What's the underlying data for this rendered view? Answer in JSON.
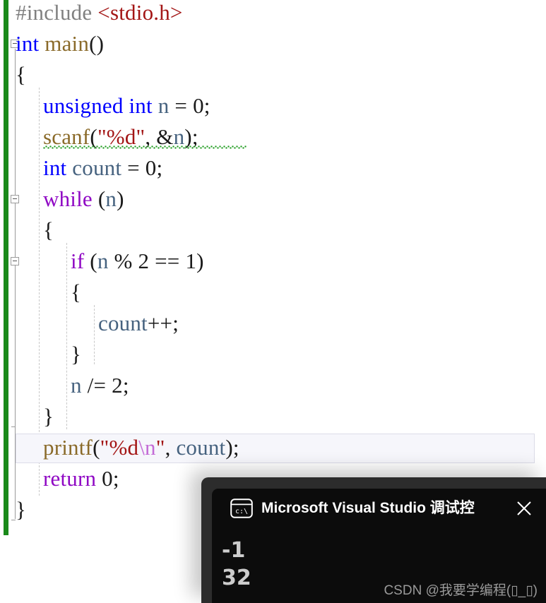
{
  "editor": {
    "language": "c",
    "background": "#ffffff",
    "change_bar_color": "#1a8a1a",
    "current_line_index": 12,
    "lines": [
      {
        "indent": 0,
        "text": "#include <stdio.h>"
      },
      {
        "indent": 0,
        "text": "int main()"
      },
      {
        "indent": 0,
        "text": "{"
      },
      {
        "indent": 1,
        "text": "unsigned int n = 0;"
      },
      {
        "indent": 1,
        "text": "scanf(\"%d\", &n);"
      },
      {
        "indent": 1,
        "text": "int count = 0;"
      },
      {
        "indent": 1,
        "text": "while (n)"
      },
      {
        "indent": 1,
        "text": "{"
      },
      {
        "indent": 2,
        "text": "if (n % 2 == 1)"
      },
      {
        "indent": 2,
        "text": "{"
      },
      {
        "indent": 3,
        "text": "count++;"
      },
      {
        "indent": 2,
        "text": "}"
      },
      {
        "indent": 2,
        "text": "n /= 2;"
      },
      {
        "indent": 1,
        "text": "}"
      },
      {
        "indent": 1,
        "text": "printf(\"%d\\n\", count);"
      },
      {
        "indent": 1,
        "text": "return 0;"
      },
      {
        "indent": 0,
        "text": "}"
      }
    ],
    "tokens": {
      "line0": [
        {
          "text": "#include ",
          "cls": "t-pre"
        },
        {
          "text": "<stdio.h>",
          "cls": "t-inc"
        }
      ],
      "line1": [
        {
          "text": "int",
          "cls": "t-key"
        },
        {
          "text": " main",
          "cls": "t-fn"
        },
        {
          "text": "()",
          "cls": "t-punct"
        }
      ],
      "line2": [
        {
          "text": "{",
          "cls": "t-punct"
        }
      ],
      "line3": [
        {
          "text": "unsigned int",
          "cls": "t-key"
        },
        {
          "text": " ",
          "cls": "t-punct"
        },
        {
          "text": "n",
          "cls": "t-var"
        },
        {
          "text": " = ",
          "cls": "t-punct"
        },
        {
          "text": "0",
          "cls": "t-num"
        },
        {
          "text": ";",
          "cls": "t-punct"
        }
      ],
      "line4": [
        {
          "text": "scanf",
          "cls": "t-fn"
        },
        {
          "text": "(",
          "cls": "t-punct"
        },
        {
          "text": "\"%d\"",
          "cls": "t-str"
        },
        {
          "text": ", &",
          "cls": "t-punct"
        },
        {
          "text": "n",
          "cls": "t-var"
        },
        {
          "text": ");",
          "cls": "t-punct"
        }
      ],
      "line5": [
        {
          "text": "int",
          "cls": "t-key"
        },
        {
          "text": " ",
          "cls": "t-punct"
        },
        {
          "text": "count",
          "cls": "t-var"
        },
        {
          "text": " = ",
          "cls": "t-punct"
        },
        {
          "text": "0",
          "cls": "t-num"
        },
        {
          "text": ";",
          "cls": "t-punct"
        }
      ],
      "line6": [
        {
          "text": "while",
          "cls": "t-ctrl"
        },
        {
          "text": " (",
          "cls": "t-punct"
        },
        {
          "text": "n",
          "cls": "t-var"
        },
        {
          "text": ")",
          "cls": "t-punct"
        }
      ],
      "line7": [
        {
          "text": "{",
          "cls": "t-punct"
        }
      ],
      "line8": [
        {
          "text": "if",
          "cls": "t-ctrl"
        },
        {
          "text": " (",
          "cls": "t-punct"
        },
        {
          "text": "n",
          "cls": "t-var"
        },
        {
          "text": " % ",
          "cls": "t-punct"
        },
        {
          "text": "2",
          "cls": "t-num"
        },
        {
          "text": " == ",
          "cls": "t-punct"
        },
        {
          "text": "1",
          "cls": "t-num"
        },
        {
          "text": ")",
          "cls": "t-punct"
        }
      ],
      "line9": [
        {
          "text": "{",
          "cls": "t-punct"
        }
      ],
      "line10": [
        {
          "text": "count",
          "cls": "t-var"
        },
        {
          "text": "++;",
          "cls": "t-punct"
        }
      ],
      "line11": [
        {
          "text": "}",
          "cls": "t-punct"
        }
      ],
      "line12": [
        {
          "text": "n",
          "cls": "t-var"
        },
        {
          "text": " /= ",
          "cls": "t-punct"
        },
        {
          "text": "2",
          "cls": "t-num"
        },
        {
          "text": ";",
          "cls": "t-punct"
        }
      ],
      "line13": [
        {
          "text": "}",
          "cls": "t-punct"
        }
      ],
      "line14": [
        {
          "text": "printf",
          "cls": "t-fn"
        },
        {
          "text": "(",
          "cls": "t-punct"
        },
        {
          "text": "\"%d",
          "cls": "t-str"
        },
        {
          "text": "\\n",
          "cls": "t-esc"
        },
        {
          "text": "\"",
          "cls": "t-str"
        },
        {
          "text": ", ",
          "cls": "t-punct"
        },
        {
          "text": "count",
          "cls": "t-var"
        },
        {
          "text": ");",
          "cls": "t-punct"
        }
      ],
      "line15": [
        {
          "text": "return",
          "cls": "t-ctrl"
        },
        {
          "text": " ",
          "cls": "t-punct"
        },
        {
          "text": "0",
          "cls": "t-num"
        },
        {
          "text": ";",
          "cls": "t-punct"
        }
      ],
      "line16": [
        {
          "text": "}",
          "cls": "t-punct"
        }
      ]
    },
    "error_squiggle": {
      "on_line": 4,
      "color": "#199a19",
      "label": "scanf-deprecation-warning"
    },
    "fold_markers": [
      {
        "label": "collapse-main-function",
        "line": 1,
        "glyph": "-"
      },
      {
        "label": "collapse-while-block",
        "line": 6,
        "glyph": "-"
      },
      {
        "label": "collapse-if-block",
        "line": 8,
        "glyph": "-"
      }
    ]
  },
  "console": {
    "title": "Microsoft Visual Studio 调试控",
    "icon_name": "console-cmd-icon",
    "icon_glyph": "c:\\",
    "close_label": "✕",
    "background": "#0c0c0c",
    "frame_background": "#2c2c2c",
    "text_color": "#cccccc",
    "output": [
      "-1",
      "32"
    ]
  },
  "watermark": {
    "text": "CSDN @我要学编程(▯_▯)"
  }
}
